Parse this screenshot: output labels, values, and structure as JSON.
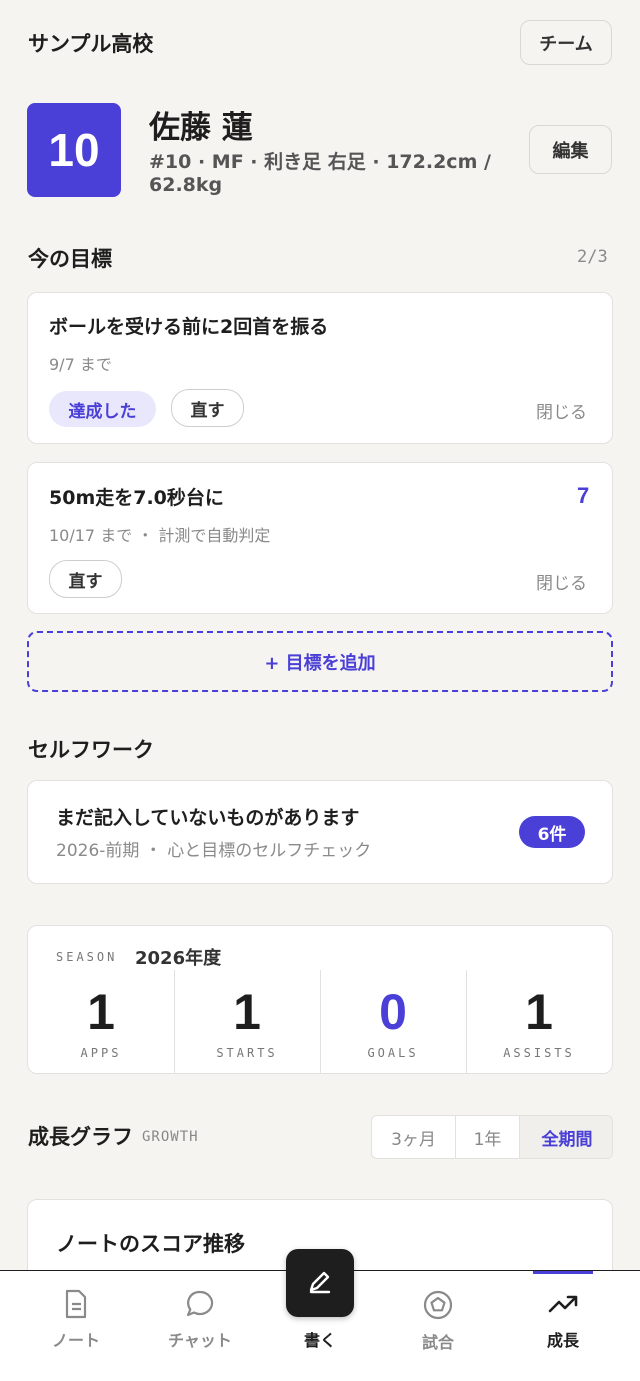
{
  "header": {
    "school": "サンプル高校",
    "team_button": "チーム"
  },
  "profile": {
    "number": "10",
    "name": "佐藤 蓮",
    "meta_line1": "#10 · MF · 利き足 右足 · 172.2cm /",
    "meta_line2": "62.8kg",
    "edit_button": "編集"
  },
  "goals": {
    "title": "今の目標",
    "count": "2/3",
    "items": [
      {
        "title": "ボールを受ける前に2回首を振る",
        "deadline": "9/7 まで",
        "achieved_label": "達成した",
        "fix_label": "直す",
        "close_label": "閉じる"
      },
      {
        "title": "50m走を7.0秒台に",
        "deadline": "10/17 まで ・ 計測で自動判定",
        "badge": "7",
        "fix_label": "直す",
        "close_label": "閉じる"
      }
    ],
    "add_label": "+ 目標を追加"
  },
  "selfwork": {
    "title": "セルフワーク",
    "card_title": "まだ記入していないものがあります",
    "card_sub": "2026-前期 ・ 心と目標のセルフチェック",
    "badge": "6件"
  },
  "season": {
    "label": "SEASON",
    "year": "2026年度",
    "stats": [
      {
        "value": "1",
        "label": "APPS"
      },
      {
        "value": "1",
        "label": "STARTS"
      },
      {
        "value": "0",
        "label": "GOALS"
      },
      {
        "value": "1",
        "label": "ASSISTS"
      }
    ]
  },
  "growth": {
    "title": "成長グラフ",
    "subtitle": "GROWTH",
    "ranges": [
      "3ヶ月",
      "1年",
      "全期間"
    ],
    "selected_range": "全期間",
    "card_title": "ノートのスコア推移"
  },
  "nav": {
    "items": [
      {
        "label": "ノート",
        "icon": "note-icon"
      },
      {
        "label": "チャット",
        "icon": "chat-icon"
      },
      {
        "label": "書く",
        "icon": "pen-icon"
      },
      {
        "label": "試合",
        "icon": "ball-icon"
      },
      {
        "label": "成長",
        "icon": "trend-icon"
      }
    ],
    "active": "成長"
  },
  "colors": {
    "accent": "#4a3fd6",
    "accent_soft": "#e9e7fb",
    "background": "#f5f4f1"
  }
}
